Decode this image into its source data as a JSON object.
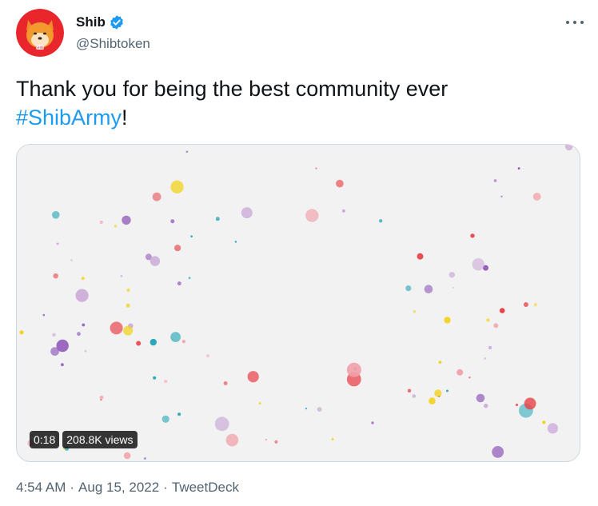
{
  "author": {
    "display_name": "Shib",
    "handle": "@Shibtoken",
    "verified": true,
    "avatar_icon": "shiba-inu-avatar-icon"
  },
  "menu_icon": "more-horizontal-icon",
  "tweet": {
    "text": "Thank you for being the best community ever",
    "hashtag": "#ShibArmy",
    "suffix": "!"
  },
  "media": {
    "type": "video",
    "duration": "0:18",
    "views": "208.8K views"
  },
  "meta": {
    "time": "4:54 AM",
    "separator": "·",
    "date": "Aug 15, 2022",
    "source": "TweetDeck"
  },
  "colors": {
    "link": "#1d9bf0",
    "verified": "#1d9bf0",
    "secondary_text": "#536471",
    "avatar_background": "#e8262b",
    "dot_colors": [
      "#e8434b",
      "#2ba7b8",
      "#8e55b8",
      "#f2d21b",
      "#c9a6d6",
      "#f0a0a8"
    ]
  }
}
